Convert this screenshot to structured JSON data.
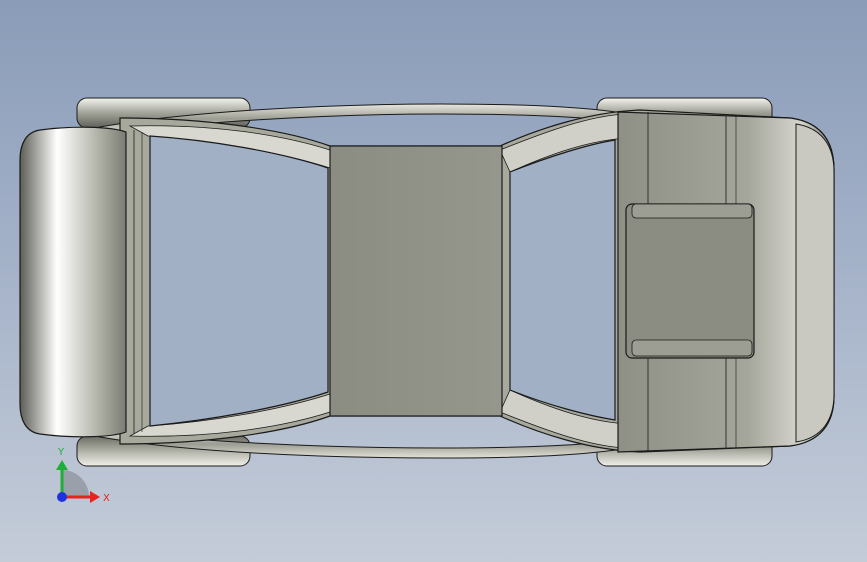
{
  "triad": {
    "x_label": "X",
    "y_label": "Y",
    "x_color": "#e8231f",
    "y_color": "#1fae3a",
    "z_color": "#2032e0"
  },
  "model": {
    "body_color": "#8e8f84",
    "shell_color": "#a7a89c",
    "outline_color": "#1a1a1a"
  }
}
